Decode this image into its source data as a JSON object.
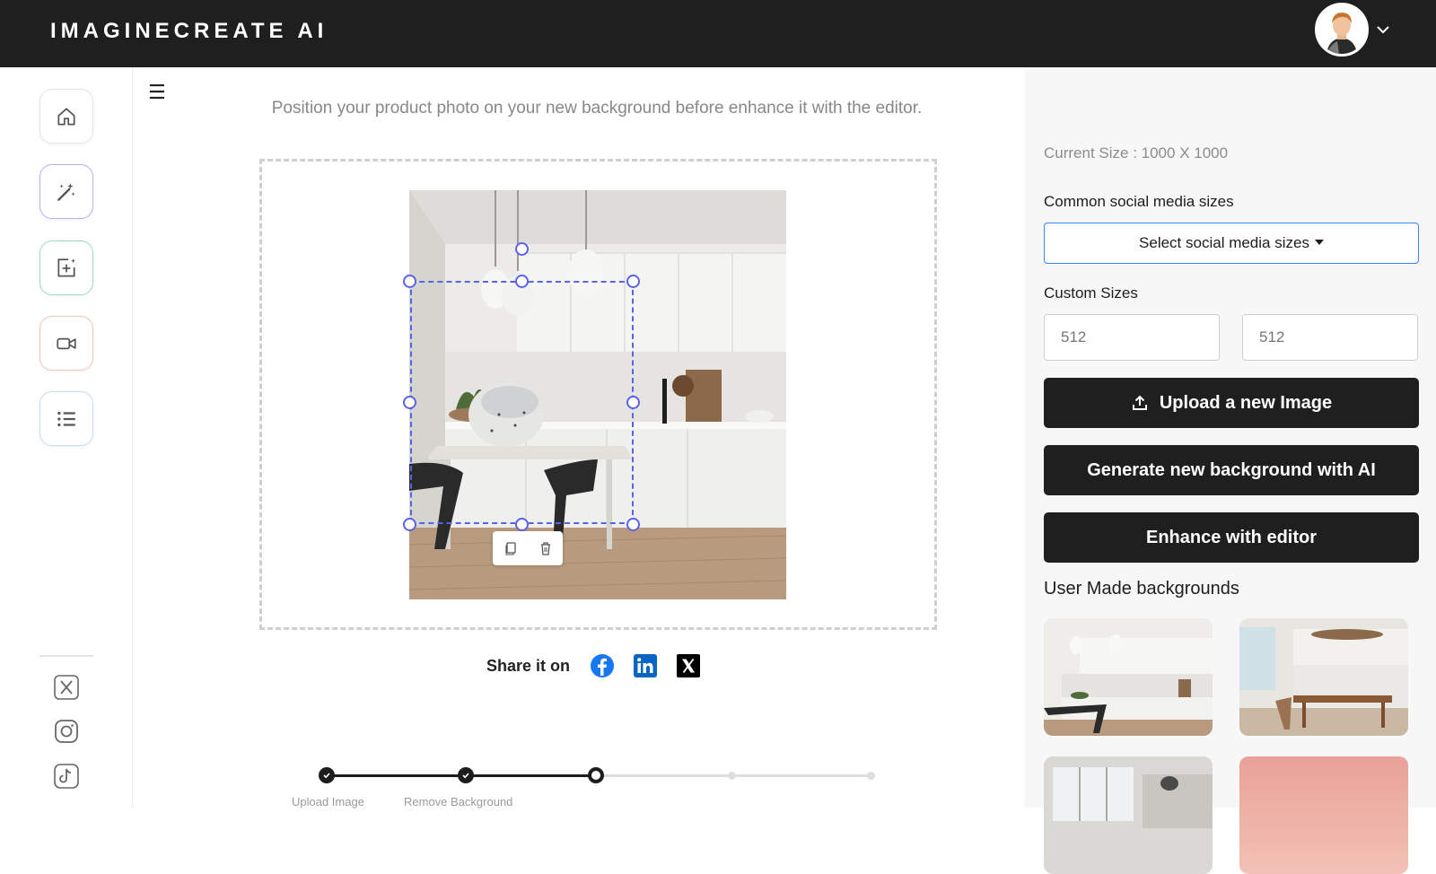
{
  "brand": {
    "name": "IMAGINECREATE AI"
  },
  "header": {
    "avatar_icon": "user-avatar-icon",
    "menu_icon": "chevron-down-icon"
  },
  "sidebar": {
    "items": [
      {
        "icon": "home-icon",
        "accent": "#e5e5e5"
      },
      {
        "icon": "magic-wand-icon",
        "accent": "#b8aef0"
      },
      {
        "icon": "add-image-icon",
        "accent": "#9fdac9"
      },
      {
        "icon": "video-camera-icon",
        "accent": "#f3c7b8"
      },
      {
        "icon": "list-icon",
        "accent": "#c6dcf3"
      }
    ],
    "socials": [
      "x-icon",
      "instagram-icon",
      "tiktok-icon"
    ]
  },
  "editor": {
    "instruction": "Position your product photo on your new background before enhance it with the editor.",
    "selection_color": "#5a63e8",
    "toolbar": [
      "copy-icon",
      "trash-icon"
    ]
  },
  "share": {
    "label": "Share it on",
    "networks": [
      "facebook-icon",
      "linkedin-icon",
      "x-icon"
    ]
  },
  "stepper": {
    "steps": [
      {
        "label": "Upload Image",
        "state": "done"
      },
      {
        "label": "Remove Background",
        "state": "done"
      },
      {
        "label": "",
        "state": "current"
      },
      {
        "label": "",
        "state": "upcoming"
      },
      {
        "label": "",
        "state": "upcoming"
      }
    ]
  },
  "panel": {
    "current_size": "Current Size : 1000 X 1000",
    "social_sizes_label": "Common social media sizes",
    "social_sizes_button": "Select social media sizes",
    "custom_sizes_label": "Custom Sizes",
    "width_placeholder": "512",
    "height_placeholder": "512",
    "upload_button": "Upload a new Image",
    "generate_button": "Generate new background with AI",
    "enhance_button": "Enhance with editor",
    "user_backgrounds_title": "User Made backgrounds"
  }
}
